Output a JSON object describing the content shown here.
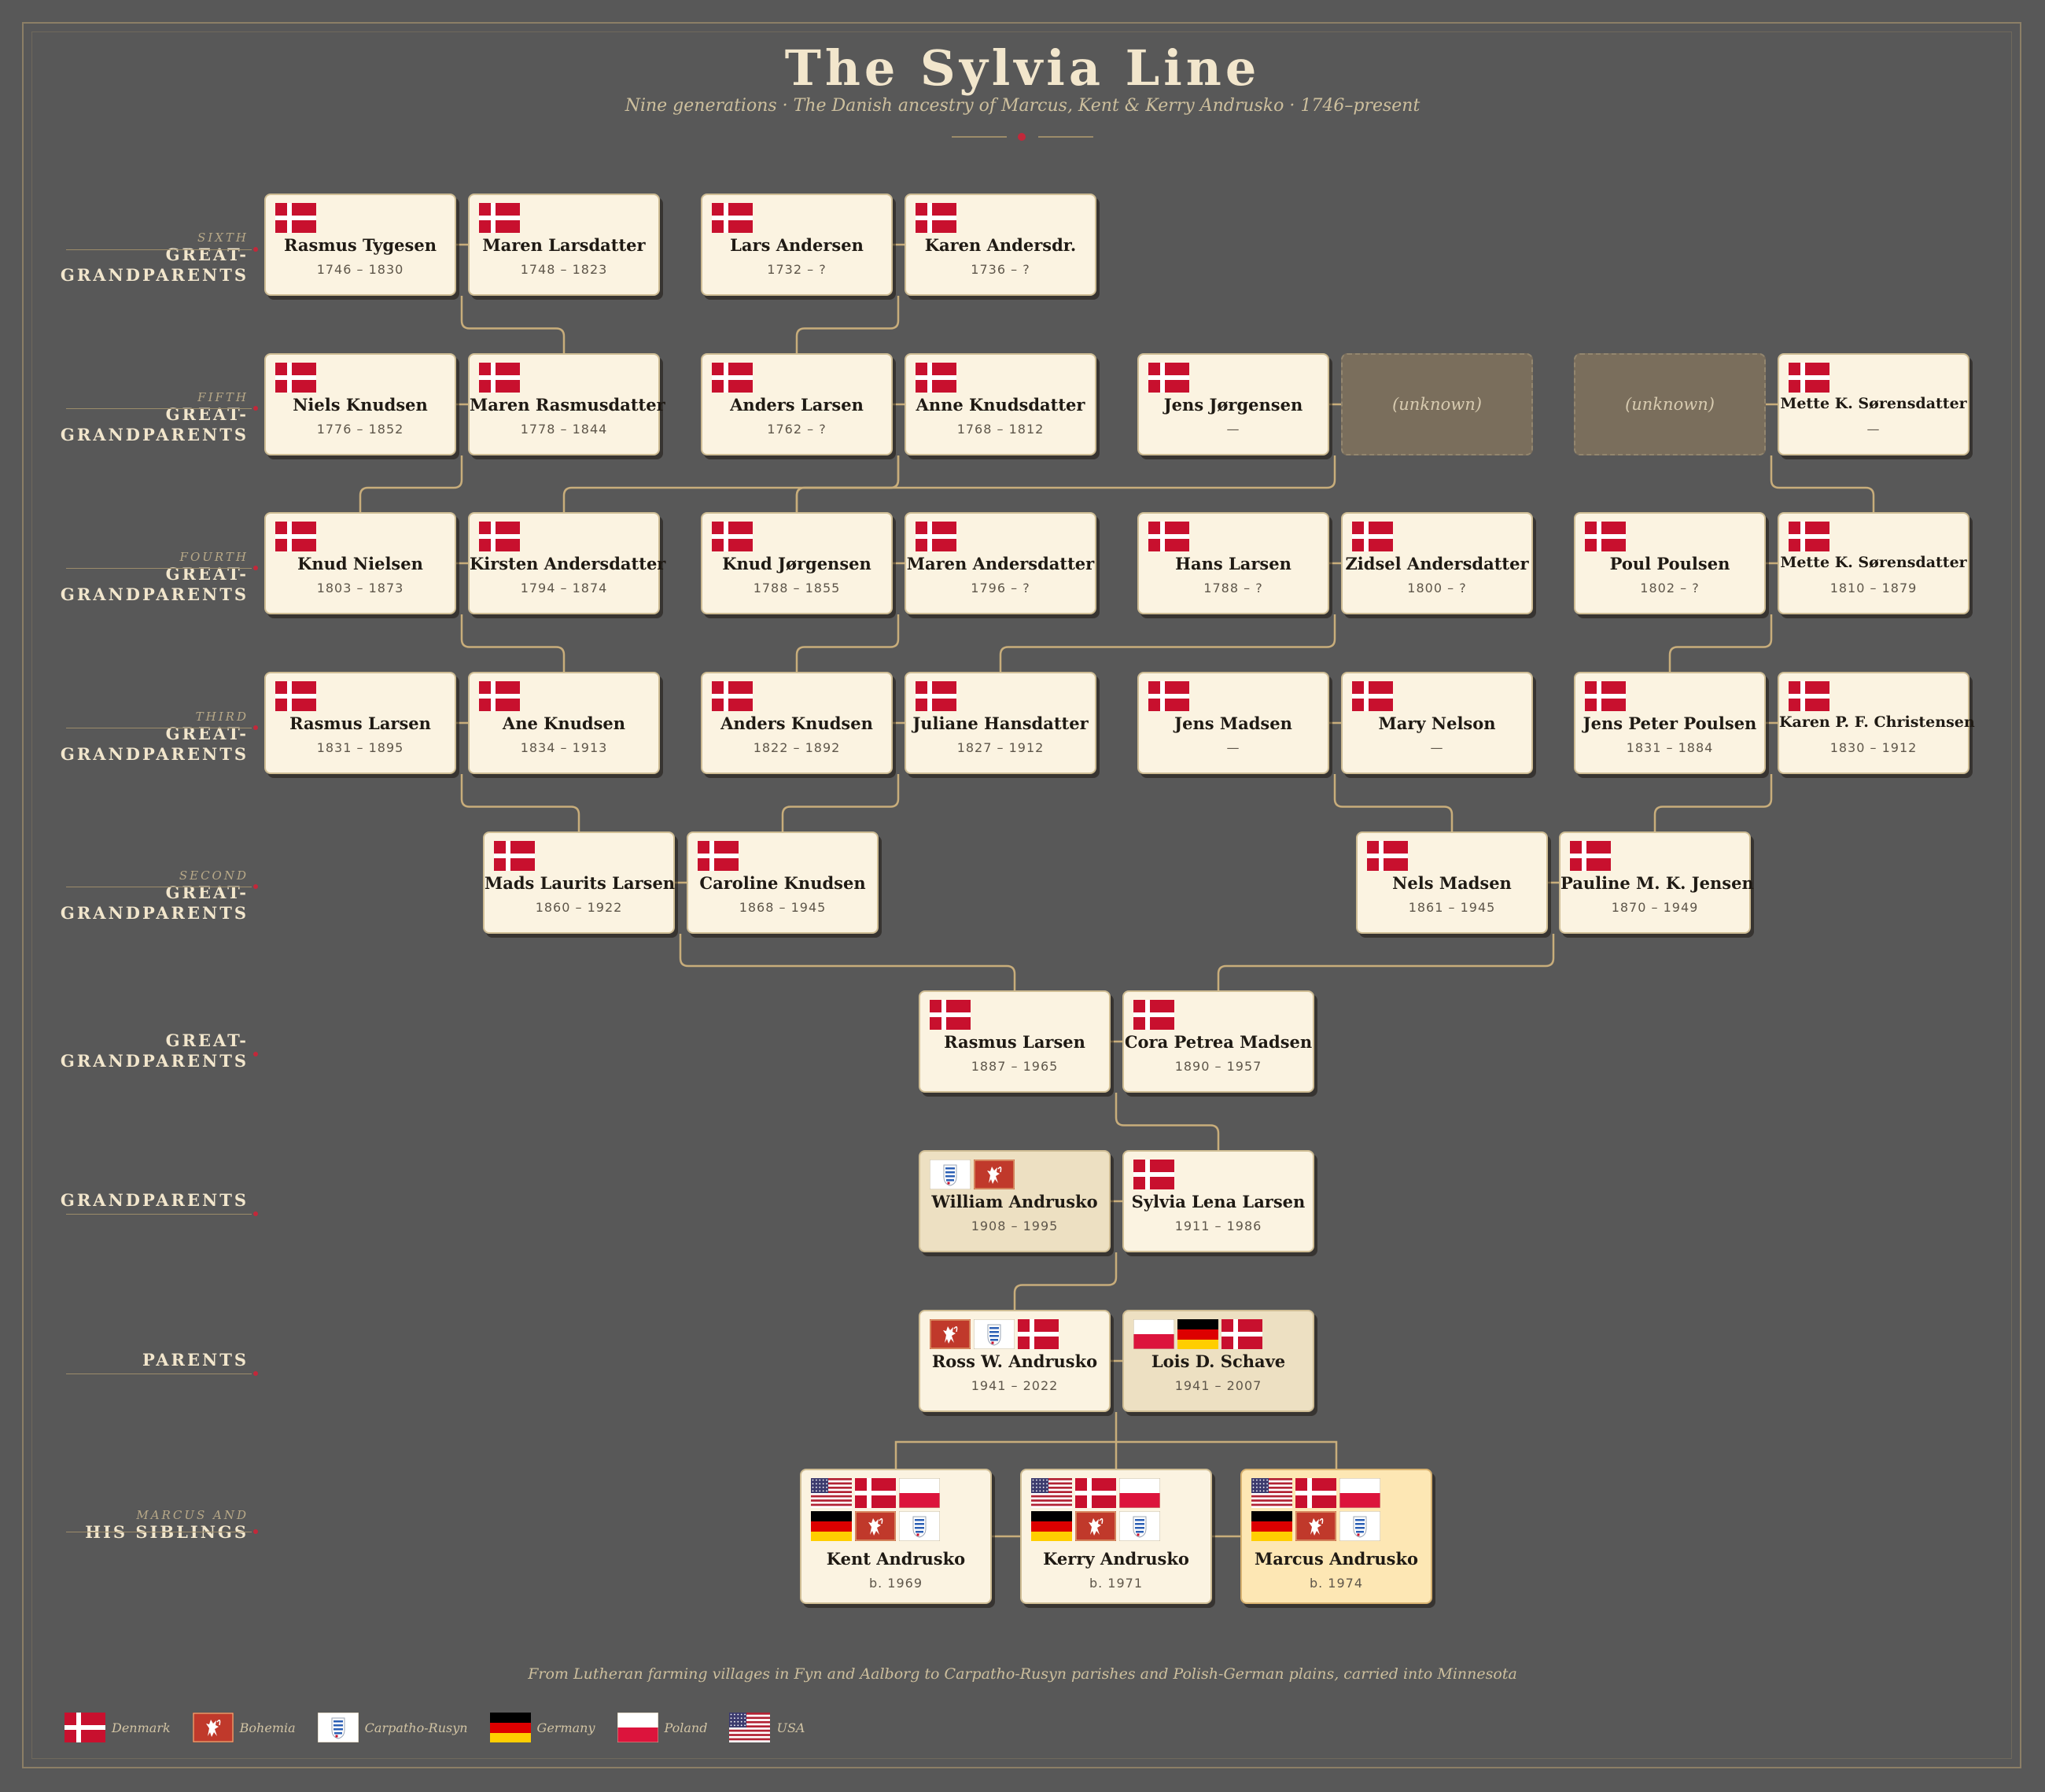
{
  "title": "The Sylvia Line",
  "subtitle": "Nine generations · The Danish ancestry of Marcus, Kent & Kerry Andrusko · 1746–present",
  "generations": [
    {
      "small": "SIXTH",
      "big": "GREAT-GRANDPARENTS"
    },
    {
      "small": "FIFTH",
      "big": "GREAT-GRANDPARENTS"
    },
    {
      "small": "FOURTH",
      "big": "GREAT-GRANDPARENTS"
    },
    {
      "small": "THIRD",
      "big": "GREAT-GRANDPARENTS"
    },
    {
      "small": "SECOND",
      "big": "GREAT-GRANDPARENTS"
    },
    {
      "small": "",
      "big": "GREAT-GRANDPARENTS"
    },
    {
      "small": "",
      "big": "GRANDPARENTS"
    },
    {
      "small": "",
      "big": "PARENTS"
    },
    {
      "small": "MARCUS AND",
      "big": "HIS SIBLINGS"
    }
  ],
  "people": {
    "p6a": {
      "name": "Rasmus Tygesen",
      "dates": "1746 – 1830",
      "flags": [
        "denmark"
      ]
    },
    "p6b": {
      "name": "Maren Larsdatter",
      "dates": "1748 – 1823",
      "flags": [
        "denmark"
      ]
    },
    "p6c": {
      "name": "Lars Andersen",
      "dates": "1732 – ?",
      "flags": [
        "denmark"
      ]
    },
    "p6d": {
      "name": "Karen Andersdr.",
      "dates": "1736 – ?",
      "flags": [
        "denmark"
      ]
    },
    "p5a": {
      "name": "Niels Knudsen",
      "dates": "1776 – 1852",
      "flags": [
        "denmark"
      ]
    },
    "p5b": {
      "name": "Maren Rasmusdatter",
      "dates": "1778 – 1844",
      "flags": [
        "denmark"
      ]
    },
    "p5c": {
      "name": "Anders Larsen",
      "dates": "1762 – ?",
      "flags": [
        "denmark"
      ]
    },
    "p5d": {
      "name": "Anne Knudsdatter",
      "dates": "1768 – 1812",
      "flags": [
        "denmark"
      ]
    },
    "p5e": {
      "name": "Jens Jørgensen",
      "dates": "—",
      "flags": [
        "denmark"
      ]
    },
    "p5f": {
      "unknown": "(unknown)"
    },
    "p5g": {
      "unknown": "(unknown)"
    },
    "p5h": {
      "name": "Mette K. Sørensdatter",
      "dates": "—",
      "flags": [
        "denmark"
      ]
    },
    "p4a": {
      "name": "Knud Nielsen",
      "dates": "1803 – 1873",
      "flags": [
        "denmark"
      ]
    },
    "p4b": {
      "name": "Kirsten Andersdatter",
      "dates": "1794 – 1874",
      "flags": [
        "denmark"
      ]
    },
    "p4c": {
      "name": "Knud Jørgensen",
      "dates": "1788 – 1855",
      "flags": [
        "denmark"
      ]
    },
    "p4d": {
      "name": "Maren Andersdatter",
      "dates": "1796 – ?",
      "flags": [
        "denmark"
      ]
    },
    "p4e": {
      "name": "Hans Larsen",
      "dates": "1788 – ?",
      "flags": [
        "denmark"
      ]
    },
    "p4f": {
      "name": "Zidsel Andersdatter",
      "dates": "1800 – ?",
      "flags": [
        "denmark"
      ]
    },
    "p4g": {
      "name": "Poul Poulsen",
      "dates": "1802 – ?",
      "flags": [
        "denmark"
      ]
    },
    "p4h": {
      "name": "Mette K. Sørensdatter",
      "dates": "1810 – 1879",
      "flags": [
        "denmark"
      ]
    },
    "p3a": {
      "name": "Rasmus Larsen",
      "dates": "1831 – 1895",
      "flags": [
        "denmark"
      ]
    },
    "p3b": {
      "name": "Ane Knudsen",
      "dates": "1834 – 1913",
      "flags": [
        "denmark"
      ]
    },
    "p3c": {
      "name": "Anders Knudsen",
      "dates": "1822 – 1892",
      "flags": [
        "denmark"
      ]
    },
    "p3d": {
      "name": "Juliane Hansdatter",
      "dates": "1827 – 1912",
      "flags": [
        "denmark"
      ]
    },
    "p3e": {
      "name": "Jens Madsen",
      "dates": "—",
      "flags": [
        "denmark"
      ]
    },
    "p3f": {
      "name": "Mary Nelson",
      "dates": "—",
      "flags": [
        "denmark"
      ]
    },
    "p3g": {
      "name": "Jens Peter Poulsen",
      "dates": "1831 – 1884",
      "flags": [
        "denmark"
      ]
    },
    "p3h": {
      "name": "Karen P. F. Christensen",
      "dates": "1830 – 1912",
      "flags": [
        "denmark"
      ]
    },
    "p2a": {
      "name": "Mads Laurits Larsen",
      "dates": "1860 – 1922",
      "flags": [
        "denmark"
      ]
    },
    "p2b": {
      "name": "Caroline Knudsen",
      "dates": "1868 – 1945",
      "flags": [
        "denmark"
      ]
    },
    "p2c": {
      "name": "Nels Madsen",
      "dates": "1861 – 1945",
      "flags": [
        "denmark"
      ]
    },
    "p2d": {
      "name": "Pauline M. K. Jensen",
      "dates": "1870 – 1949",
      "flags": [
        "denmark"
      ]
    },
    "p1a": {
      "name": "Rasmus Larsen",
      "dates": "1887 – 1965",
      "flags": [
        "denmark"
      ]
    },
    "p1b": {
      "name": "Cora Petrea Madsen",
      "dates": "1890 – 1957",
      "flags": [
        "denmark"
      ]
    },
    "gpa": {
      "name": "William Andrusko",
      "dates": "1908 – 1995",
      "flags": [
        "rusyn",
        "bohemia"
      ]
    },
    "gpb": {
      "name": "Sylvia Lena Larsen",
      "dates": "1911 – 1986",
      "flags": [
        "denmark"
      ]
    },
    "pa": {
      "name": "Ross W. Andrusko",
      "dates": "1941 – 2022",
      "flags": [
        "bohemia",
        "rusyn",
        "denmark"
      ]
    },
    "pb": {
      "name": "Lois D. Schave",
      "dates": "1941 – 2007",
      "flags": [
        "poland",
        "germany",
        "denmark"
      ]
    },
    "ka": {
      "name": "Kent Andrusko",
      "dates": "b. 1969",
      "flags": [
        "usa",
        "denmark",
        "poland",
        "germany",
        "bohemia",
        "rusyn"
      ]
    },
    "kb": {
      "name": "Kerry Andrusko",
      "dates": "b. 1971",
      "flags": [
        "usa",
        "denmark",
        "poland",
        "germany",
        "bohemia",
        "rusyn"
      ]
    },
    "kc": {
      "name": "Marcus Andrusko",
      "dates": "b. 1974",
      "flags": [
        "usa",
        "denmark",
        "poland",
        "germany",
        "bohemia",
        "rusyn"
      ]
    }
  },
  "footer": "From Lutheran farming villages in Fyn and Aalborg to Carpatho-Rusyn parishes and Polish-German plains, carried into Minnesota",
  "legend": [
    {
      "flag": "denmark",
      "label": "Denmark"
    },
    {
      "flag": "bohemia",
      "label": "Bohemia"
    },
    {
      "flag": "rusyn",
      "label": "Carpatho-Rusyn"
    },
    {
      "flag": "germany",
      "label": "Germany"
    },
    {
      "flag": "poland",
      "label": "Poland"
    },
    {
      "flag": "usa",
      "label": "USA"
    }
  ],
  "colors": {
    "background": "#585858",
    "card": "#fbf3e1",
    "card_tan": "#ede0c2",
    "card_highlight": "#fde7b4",
    "connector": "#c8ad7b",
    "accent": "#c2283a",
    "title": "#f2e6cc"
  }
}
